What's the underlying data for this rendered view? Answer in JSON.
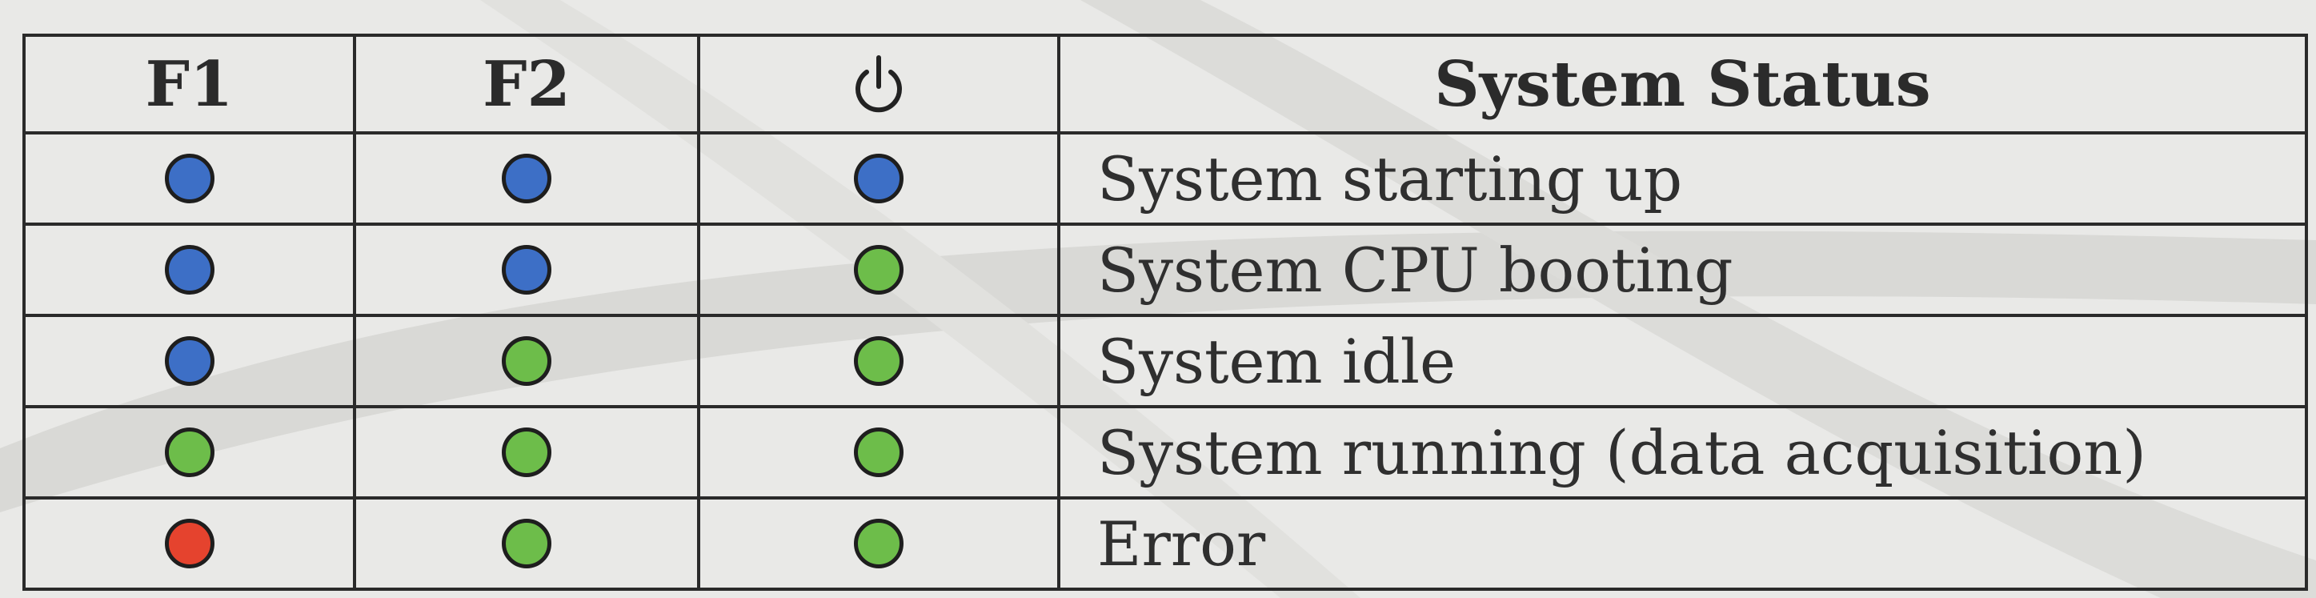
{
  "header": {
    "f1": "F1",
    "f2": "F2",
    "power_icon": "power-icon",
    "status": "System Status"
  },
  "rows": [
    {
      "f1": "#3d6fc6",
      "f2": "#3d6fc6",
      "power": "#3d6fc6",
      "status": "System starting up"
    },
    {
      "f1": "#3d6fc6",
      "f2": "#3d6fc6",
      "power": "#6dbd4a",
      "status": "System CPU booting"
    },
    {
      "f1": "#3d6fc6",
      "f2": "#6dbd4a",
      "power": "#6dbd4a",
      "status": "System idle"
    },
    {
      "f1": "#6dbd4a",
      "f2": "#6dbd4a",
      "power": "#6dbd4a",
      "status": "System running (data acquisition)"
    },
    {
      "f1": "#e5432e",
      "f2": "#6dbd4a",
      "power": "#6dbd4a",
      "status": "Error"
    }
  ]
}
